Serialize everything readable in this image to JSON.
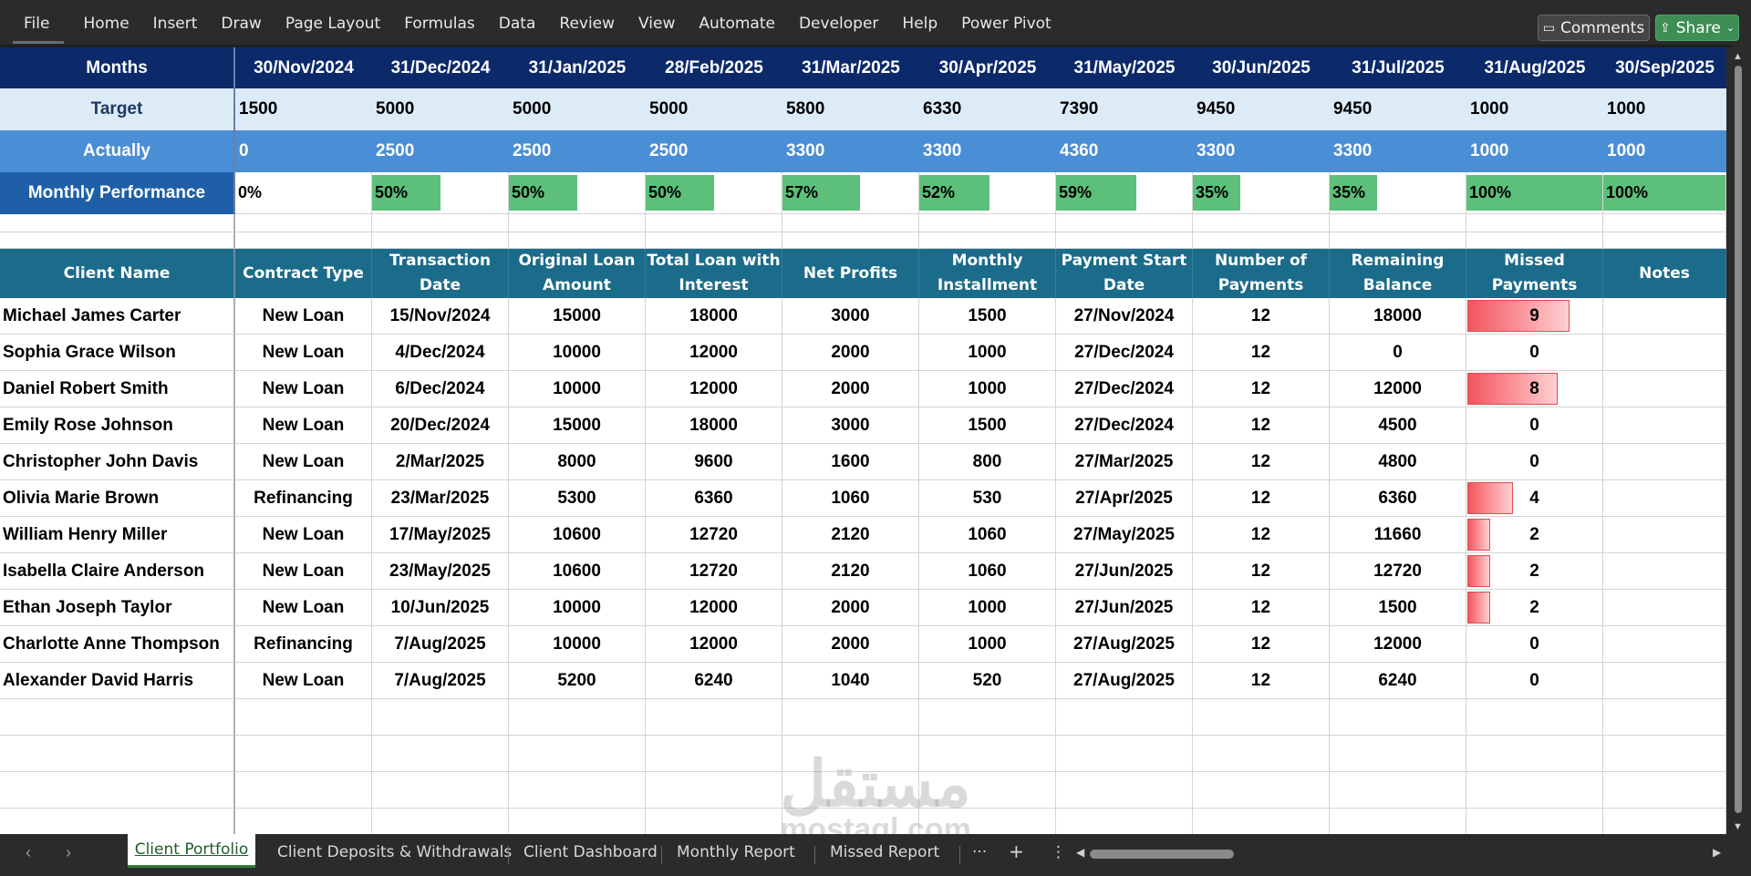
{
  "ribbon": {
    "menu": [
      "File",
      "Home",
      "Insert",
      "Draw",
      "Page Layout",
      "Formulas",
      "Data",
      "Review",
      "View",
      "Automate",
      "Developer",
      "Help",
      "Power Pivot"
    ],
    "comments_label": "Comments",
    "share_label": "Share"
  },
  "summary": {
    "months_label": "Months",
    "target_label": "Target",
    "actual_label": "Actually",
    "performance_label": "Monthly Performance",
    "months": [
      "30/Nov/2024",
      "31/Dec/2024",
      "31/Jan/2025",
      "28/Feb/2025",
      "31/Mar/2025",
      "30/Apr/2025",
      "31/May/2025",
      "30/Jun/2025",
      "31/Jul/2025",
      "31/Aug/2025",
      "30/Sep/2025"
    ],
    "target": [
      "1500",
      "5000",
      "5000",
      "5000",
      "5800",
      "6330",
      "7390",
      "9450",
      "9450",
      "1000",
      "1000"
    ],
    "actual": [
      "0",
      "2500",
      "2500",
      "2500",
      "3300",
      "3300",
      "4360",
      "3300",
      "3300",
      "1000",
      "1000"
    ],
    "performance": [
      "0%",
      "50%",
      "50%",
      "50%",
      "57%",
      "52%",
      "59%",
      "35%",
      "35%",
      "100%",
      "100%"
    ],
    "performance_fraction": [
      0,
      0.5,
      0.5,
      0.5,
      0.57,
      0.52,
      0.59,
      0.35,
      0.35,
      1.0,
      1.0
    ]
  },
  "table": {
    "headers": [
      "Client Name",
      "Contract Type",
      "Transaction Date",
      "Original Loan Amount",
      "Total Loan with Interest",
      "Net Profits",
      "Monthly Installment",
      "Payment Start Date",
      "Number of Payments",
      "Remaining Balance",
      "Missed Payments",
      "Notes"
    ],
    "rows": [
      [
        "Michael James Carter",
        "New Loan",
        "15/Nov/2024",
        "15000",
        "18000",
        "3000",
        "1500",
        "27/Nov/2024",
        "12",
        "18000",
        "9",
        ""
      ],
      [
        "Sophia Grace Wilson",
        "New Loan",
        "4/Dec/2024",
        "10000",
        "12000",
        "2000",
        "1000",
        "27/Dec/2024",
        "12",
        "0",
        "0",
        ""
      ],
      [
        "Daniel Robert Smith",
        "New Loan",
        "6/Dec/2024",
        "10000",
        "12000",
        "2000",
        "1000",
        "27/Dec/2024",
        "12",
        "12000",
        "8",
        ""
      ],
      [
        "Emily Rose Johnson",
        "New Loan",
        "20/Dec/2024",
        "15000",
        "18000",
        "3000",
        "1500",
        "27/Dec/2024",
        "12",
        "4500",
        "0",
        ""
      ],
      [
        "Christopher John Davis",
        "New Loan",
        "2/Mar/2025",
        "8000",
        "9600",
        "1600",
        "800",
        "27/Mar/2025",
        "12",
        "4800",
        "0",
        ""
      ],
      [
        "Olivia Marie Brown",
        "Refinancing",
        "23/Mar/2025",
        "5300",
        "6360",
        "1060",
        "530",
        "27/Apr/2025",
        "12",
        "6360",
        "4",
        ""
      ],
      [
        "William Henry Miller",
        "New Loan",
        "17/May/2025",
        "10600",
        "12720",
        "2120",
        "1060",
        "27/May/2025",
        "12",
        "11660",
        "2",
        ""
      ],
      [
        "Isabella Claire Anderson",
        "New Loan",
        "23/May/2025",
        "10600",
        "12720",
        "2120",
        "1060",
        "27/Jun/2025",
        "12",
        "12720",
        "2",
        ""
      ],
      [
        "Ethan Joseph Taylor",
        "New Loan",
        "10/Jun/2025",
        "10000",
        "12000",
        "2000",
        "1000",
        "27/Jun/2025",
        "12",
        "1500",
        "2",
        ""
      ],
      [
        "Charlotte Anne Thompson",
        "Refinancing",
        "7/Aug/2025",
        "10000",
        "12000",
        "2000",
        "1000",
        "27/Aug/2025",
        "12",
        "12000",
        "0",
        ""
      ],
      [
        "Alexander David Harris",
        "New Loan",
        "7/Aug/2025",
        "5200",
        "6240",
        "1040",
        "520",
        "27/Aug/2025",
        "12",
        "6240",
        "0",
        ""
      ]
    ],
    "missed_scale_max": 12
  },
  "sheets": {
    "active": "Client Portfolio",
    "others": [
      "Client Deposits & Withdrawals",
      "Client Dashboard",
      "Monthly Report",
      "Missed Report"
    ],
    "more_label": "···",
    "add_label": "+",
    "options_label": "⋮"
  },
  "watermark": {
    "main": "مستقل",
    "sub": "mostaql.com"
  },
  "colors": {
    "header_navy": "#0c2a6a",
    "target_bg": "#ddebf7",
    "actual_bg": "#4a8ed6",
    "perf_label_bg": "#1f5fa8",
    "perf_bar": "#5cc07a",
    "table_header": "#1b6b8a",
    "missed_bar": "#f2555c",
    "share_green": "#3e8e56"
  }
}
